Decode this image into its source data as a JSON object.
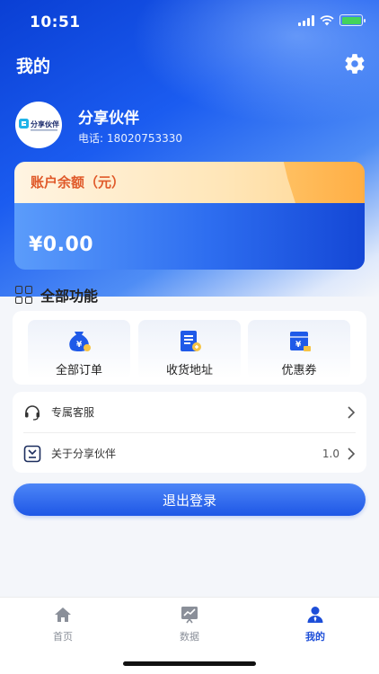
{
  "status_bar": {
    "time": "10:51"
  },
  "header": {
    "title": "我的"
  },
  "user": {
    "name": "分享伙伴",
    "phone_label": "电话:",
    "phone": "18020753330",
    "avatar_text": "分享伙伴"
  },
  "balance": {
    "label": "账户余额（元）",
    "amount": "¥0.00"
  },
  "functions": {
    "title": "全部功能",
    "items": [
      {
        "label": "全部订单",
        "icon": "money-bag-icon"
      },
      {
        "label": "收货地址",
        "icon": "address-doc-icon"
      },
      {
        "label": "优惠券",
        "icon": "coupon-icon"
      }
    ]
  },
  "list": {
    "items": [
      {
        "label": "专属客服",
        "icon": "headset-icon",
        "value": ""
      },
      {
        "label": "关于分享伙伴",
        "icon": "app-logo-icon",
        "value": "1.0"
      }
    ]
  },
  "logout_label": "退出登录",
  "tabbar": {
    "items": [
      {
        "label": "首页",
        "icon": "home-icon",
        "active": false
      },
      {
        "label": "数据",
        "icon": "chart-icon",
        "active": false
      },
      {
        "label": "我的",
        "icon": "user-icon",
        "active": true
      }
    ]
  },
  "colors": {
    "primary": "#1e57e6",
    "active_tab": "#1d4ed8",
    "balance_label": "#e05a2a"
  }
}
